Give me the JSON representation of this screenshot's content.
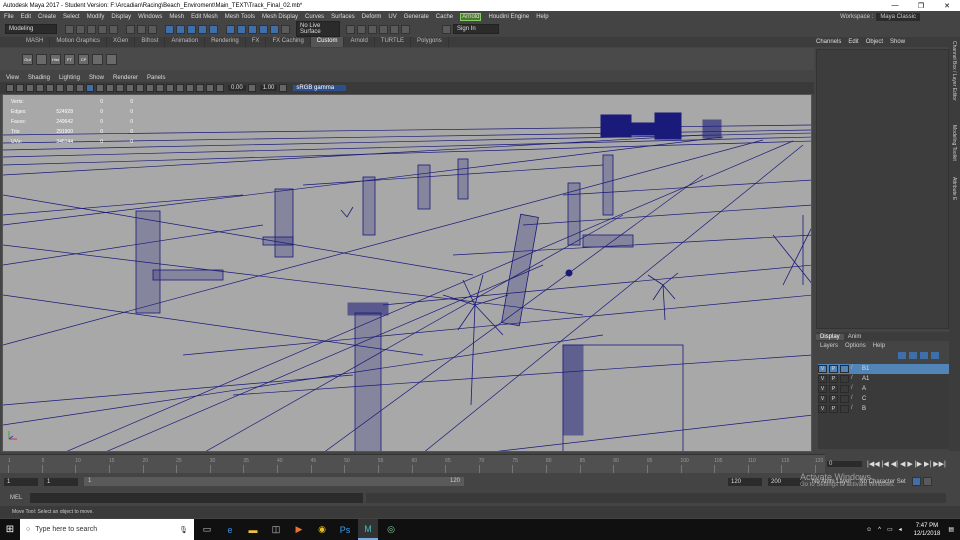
{
  "window": {
    "title": "Autodesk Maya 2017 - Student Version: F:\\Arcadian\\Racing\\Beach_Enviroment\\Main_TEXT\\Track_Final_02.mb*",
    "controls": [
      "—",
      "❐",
      "✕"
    ]
  },
  "menubar": {
    "items": [
      "File",
      "Edit",
      "Create",
      "Select",
      "Modify",
      "Display",
      "Windows",
      "Mesh",
      "Edit Mesh",
      "Mesh Tools",
      "Mesh Display",
      "Curves",
      "Surfaces",
      "Deform",
      "UV",
      "Generate",
      "Cache",
      "Arnold",
      "Houdini Engine",
      "Help"
    ],
    "highlighted": "Arnold",
    "workspace_label": "Workspace :",
    "workspace_value": "Maya Classic"
  },
  "statusline": {
    "mode": "Modeling",
    "live_surface": "No Live Surface",
    "sign_in": "Sign In"
  },
  "shelf": {
    "tabs": [
      "MASH",
      "Motion Graphics",
      "XGen",
      "Bifrost",
      "Animation",
      "Rendering",
      "FX",
      "FX Caching",
      "Custom",
      "Arnold",
      "TURTLE",
      "Polygons"
    ],
    "active_tab": "Custom",
    "buttons": [
      "Out",
      "",
      "Hist",
      "FT",
      "CP"
    ]
  },
  "panel_menu": [
    "View",
    "Shading",
    "Lighting",
    "Show",
    "Renderer",
    "Panels"
  ],
  "viewport_toolbar": {
    "value1": "0.00",
    "value2": "1.00",
    "color_mode": "sRGB gamma"
  },
  "hud": {
    "rows": [
      {
        "label": "Verts:",
        "v1": "",
        "v2": "0",
        "v3": "0"
      },
      {
        "label": "Edges:",
        "v1": "524928",
        "v2": "0",
        "v3": "0"
      },
      {
        "label": "Faces:",
        "v1": "249642",
        "v2": "0",
        "v3": "0"
      },
      {
        "label": "Tris:",
        "v1": "291900",
        "v2": "0",
        "v3": "0"
      },
      {
        "label": "UVs:",
        "v1": "346144",
        "v2": "0",
        "v3": "0"
      }
    ]
  },
  "sidebar": {
    "tabs": [
      "Channels",
      "Edit",
      "Object",
      "Show"
    ],
    "vertical_tabs": [
      "Channel Box / Layer Editor",
      "Modeling Toolkit",
      "Attribute E"
    ]
  },
  "layers": {
    "tabs": [
      "Display",
      "Anim"
    ],
    "active_tab": "Display",
    "menu": [
      "Layers",
      "Options",
      "Help"
    ],
    "rows": [
      {
        "v": "V",
        "p": "P",
        "name": "B1",
        "selected": true
      },
      {
        "v": "V",
        "p": "P",
        "name": "A1",
        "selected": false
      },
      {
        "v": "V",
        "p": "P",
        "name": "A",
        "selected": false
      },
      {
        "v": "V",
        "p": "P",
        "name": "C",
        "selected": false
      },
      {
        "v": "V",
        "p": "P",
        "name": "B",
        "selected": false
      }
    ]
  },
  "timeslider": {
    "ticks": [
      "1",
      "5",
      "10",
      "15",
      "20",
      "25",
      "30",
      "35",
      "40",
      "45",
      "50",
      "55",
      "60",
      "65",
      "70",
      "75",
      "80",
      "85",
      "90",
      "95",
      "100",
      "105",
      "110",
      "115",
      "120"
    ],
    "current_frame": "0",
    "controls": [
      "|◀◀",
      "|◀",
      "◀|",
      "◀",
      "▶",
      "|▶",
      "▶|",
      "▶▶|"
    ]
  },
  "range": {
    "start": "1",
    "start_inner": "1",
    "slider_left": "1",
    "slider_right": "120",
    "end_inner": "120",
    "end": "200",
    "anim_layer": "No Anim Layer",
    "char_set": "No Character Set"
  },
  "mel": {
    "label": "MEL"
  },
  "helpline": {
    "text": "Move Tool: Select an object to move."
  },
  "watermark": {
    "line1": "Activate Windows",
    "line2": "Go to Settings to activate Windows."
  },
  "taskbar": {
    "search_placeholder": "Type here to search",
    "time": "7:47 PM",
    "date": "12/1/2018"
  },
  "colors": {
    "wire": "#1a1a7a",
    "viewport_bg": "#a8a8a8",
    "accent": "#3f6fa8",
    "layer_selected": "#5285b7"
  }
}
